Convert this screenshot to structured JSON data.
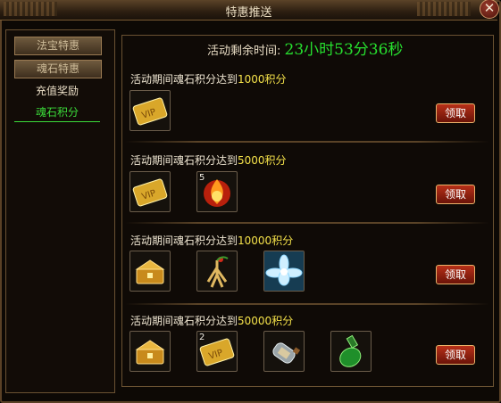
{
  "window": {
    "title": "特惠推送"
  },
  "sidebar": {
    "tabs": [
      {
        "label": "法宝特惠"
      },
      {
        "label": "魂石特惠"
      },
      {
        "label": "充值奖励"
      },
      {
        "label": "魂石积分"
      }
    ],
    "active": "魂石积分"
  },
  "timer": {
    "label": "活动剩余时间:",
    "value": "23小时53分36秒"
  },
  "rewards": [
    {
      "prefix": "活动期间魂石积分达到",
      "points": "1000积分",
      "items": [
        {
          "icon": "vip-card-icon",
          "count": ""
        }
      ],
      "claim_label": "领取"
    },
    {
      "prefix": "活动期间魂石积分达到",
      "points": "5000积分",
      "items": [
        {
          "icon": "vip-card-icon",
          "count": ""
        },
        {
          "icon": "fire-orb-icon",
          "count": "5"
        }
      ],
      "claim_label": "领取"
    },
    {
      "prefix": "活动期间魂石积分达到",
      "points": "10000积分",
      "items": [
        {
          "icon": "gold-chest-icon",
          "count": ""
        },
        {
          "icon": "ginseng-icon",
          "count": ""
        },
        {
          "icon": "snow-lotus-icon",
          "count": ""
        }
      ],
      "claim_label": "领取"
    },
    {
      "prefix": "活动期间魂石积分达到",
      "points": "50000积分",
      "items": [
        {
          "icon": "gold-chest-icon",
          "count": ""
        },
        {
          "icon": "vip-card-icon",
          "count": "2"
        },
        {
          "icon": "scroll-bottle-icon",
          "count": ""
        },
        {
          "icon": "green-potion-icon",
          "count": ""
        }
      ],
      "claim_label": "领取"
    }
  ]
}
